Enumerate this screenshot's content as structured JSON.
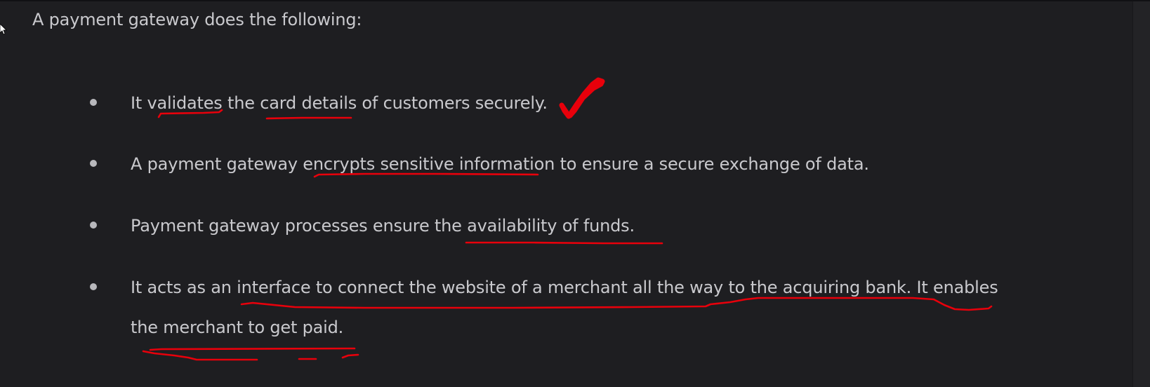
{
  "intro_text": "A payment gateway does the following:",
  "bullets": [
    {
      "line1": "It validates the card details of customers securely.",
      "line2": ""
    },
    {
      "line1": "A payment gateway encrypts sensitive information to ensure a secure exchange of data.",
      "line2": ""
    },
    {
      "line1": "Payment gateway processes ensure the availability of funds.",
      "line2": ""
    },
    {
      "line1": "It acts as an interface to connect the website of a merchant all the way to the acquiring bank. It enables",
      "line2": "the merchant to get paid."
    }
  ],
  "annotation_color": "#e8000b",
  "colors": {
    "background": "#1e1e21",
    "text": "#c9c9cd"
  },
  "icons": [
    "cursor-icon",
    "checkmark-icon"
  ]
}
